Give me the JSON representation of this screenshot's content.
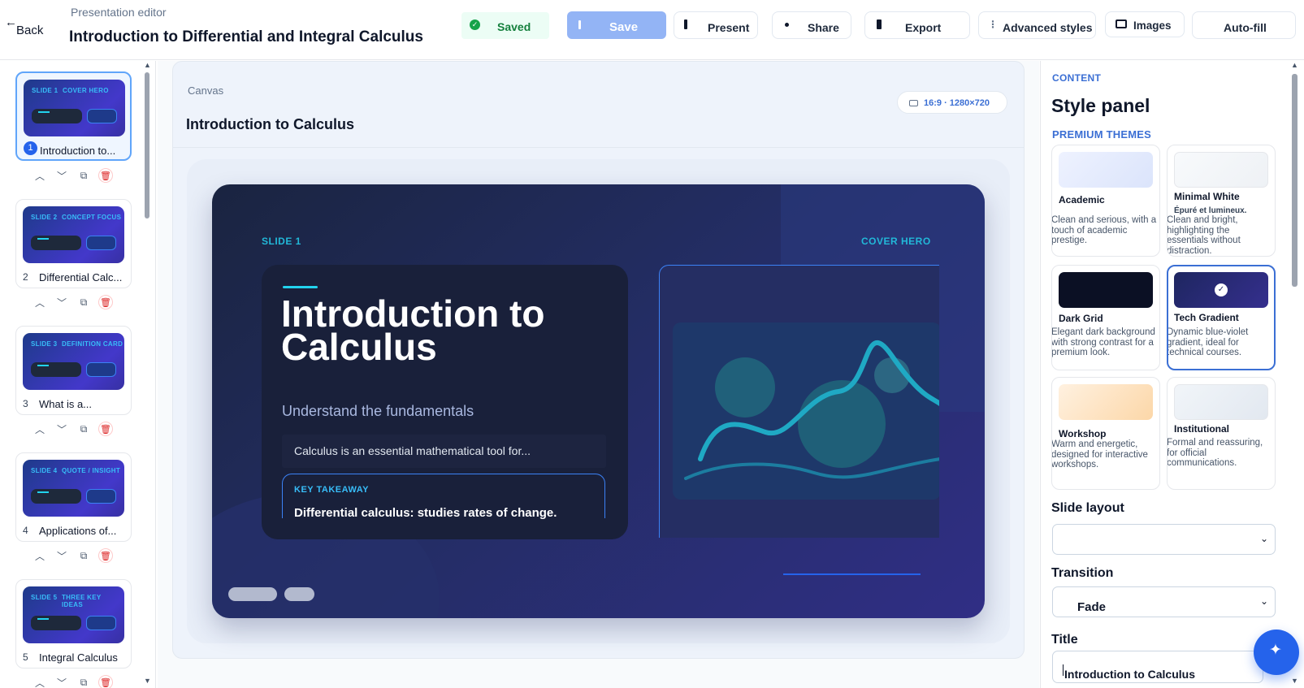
{
  "header": {
    "back_label": "Back",
    "subtitle": "Presentation editor",
    "title": "Introduction to Differential and Integral Calculus",
    "saved_status": "Saved",
    "buttons": {
      "save": "Save",
      "present": "Present",
      "share": "Share",
      "export": "Export",
      "advanced_styles": "Advanced styles",
      "images": "Images",
      "autofill": "Auto-fill"
    }
  },
  "slides": [
    {
      "num": "1",
      "title": "Introduction to...",
      "label_left": "SLIDE 1",
      "label_right": "COVER HERO"
    },
    {
      "num": "2",
      "title": "Differential Calc...",
      "label_left": "SLIDE 2",
      "label_right": "CONCEPT FOCUS"
    },
    {
      "num": "3",
      "title": "What is a...",
      "label_left": "SLIDE 3",
      "label_right": "DEFINITION CARD"
    },
    {
      "num": "4",
      "title": "Applications of...",
      "label_left": "SLIDE 4",
      "label_right": "QUOTE / INSIGHT"
    },
    {
      "num": "5",
      "title": "Integral Calculus",
      "label_left": "SLIDE 5",
      "label_right": "THREE KEY IDEAS"
    }
  ],
  "canvas": {
    "section_label": "Canvas",
    "title": "Introduction to Calculus",
    "ratio_badge": "16:9 · 1280×720",
    "slide": {
      "label_left": "SLIDE 1",
      "label_right": "COVER HERO",
      "heading": "Introduction to Calculus",
      "subheading": "Understand the fundamentals",
      "body": "Calculus is an essential mathematical tool for...",
      "takeaway_label": "KEY TAKEAWAY",
      "takeaway_text": "Differential calculus: studies rates of change."
    }
  },
  "style_panel": {
    "section": "CONTENT",
    "title": "Style panel",
    "themes_heading": "PREMIUM THEMES",
    "themes": [
      {
        "name": "Academic",
        "desc": "Clean and serious, with a touch of academic prestige."
      },
      {
        "name": "Minimal White",
        "tagline": "Épuré et lumineux.",
        "desc": "Clean and bright, highlighting the essentials without distraction."
      },
      {
        "name": "Dark Grid",
        "desc": "Elegant dark background with strong contrast for a premium look."
      },
      {
        "name": "Tech Gradient",
        "desc": "Dynamic blue-violet gradient, ideal for technical courses.",
        "selected": true
      },
      {
        "name": "Workshop",
        "desc": "Warm and energetic, designed for interactive workshops."
      },
      {
        "name": "Institutional",
        "desc": "Formal and reassuring, for official communications."
      }
    ],
    "layout_label": "Slide layout",
    "layout_value": "",
    "transition_label": "Transition",
    "transition_value": "Fade",
    "title_label": "Title",
    "title_value": "Introduction to Calculus"
  },
  "colors": {
    "accent": "#2563eb",
    "slide_bg": "#1e2b5e",
    "cyan": "#22d3ee",
    "panel_heading": "#3b6fd4"
  }
}
